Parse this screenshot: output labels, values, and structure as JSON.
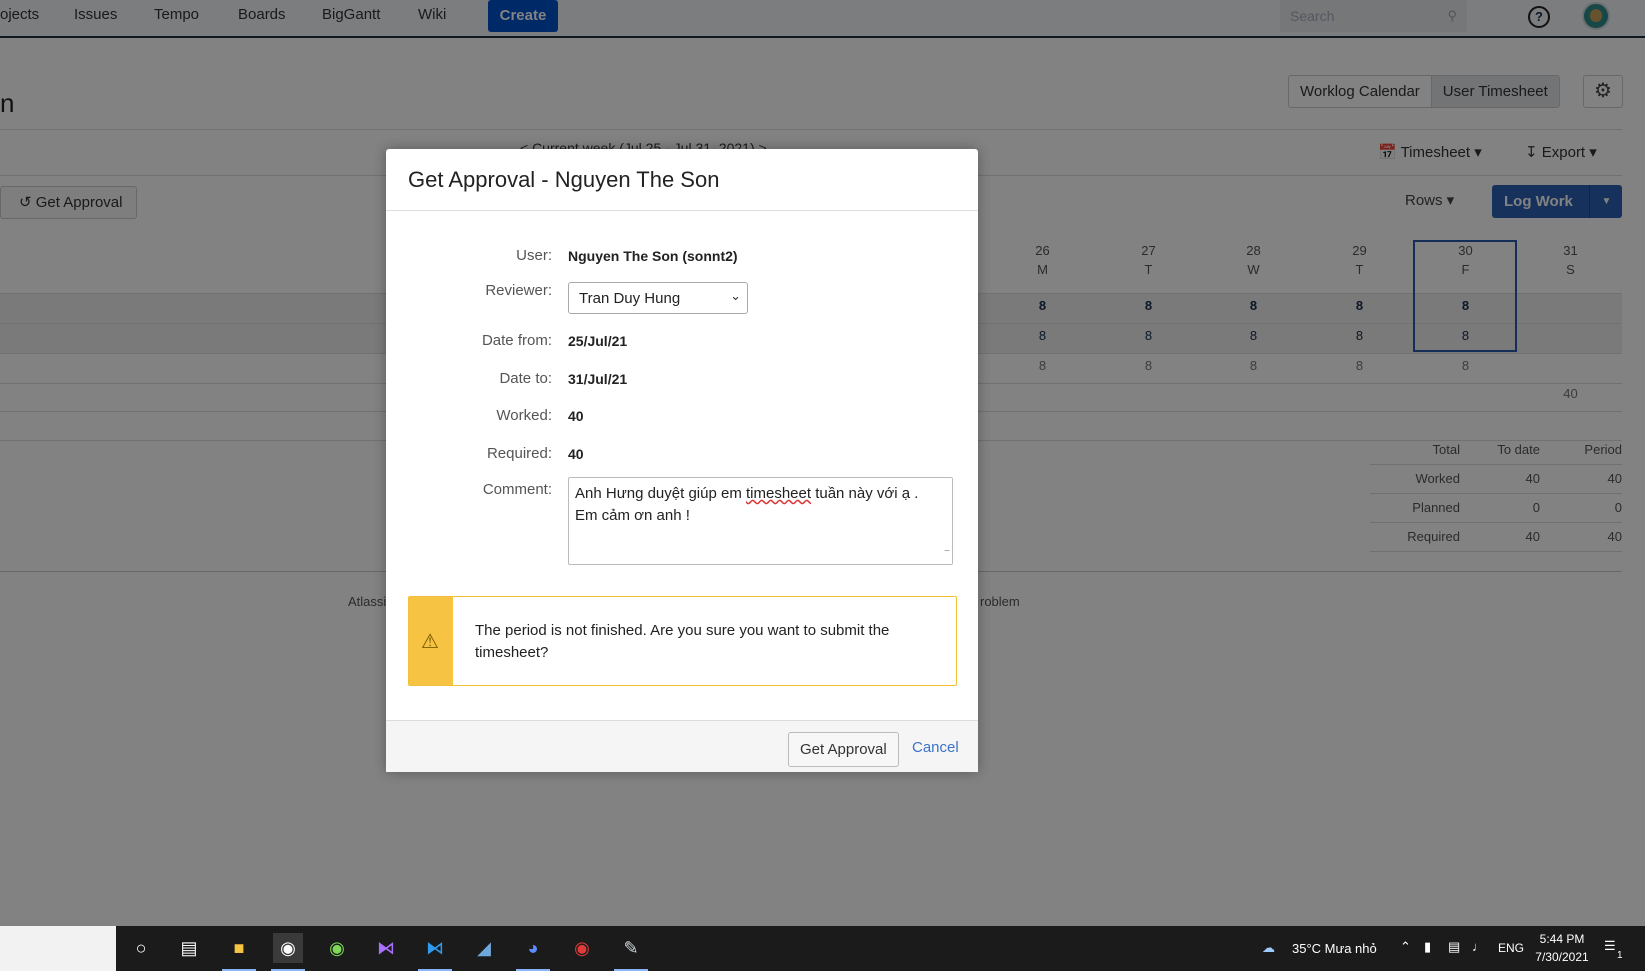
{
  "nav": {
    "items": [
      "ojects",
      "Issues",
      "Tempo",
      "Boards",
      "BigGantt",
      "Wiki"
    ],
    "create_label": "Create",
    "search_placeholder": "Search"
  },
  "page": {
    "title_fragment": "n",
    "view_tabs": [
      "Worklog Calendar",
      "User Timesheet"
    ],
    "period_nav": "< Current week (Jul 25 - Jul 31, 2021) >",
    "timesheet_label": "Timesheet",
    "export_label": "Export",
    "get_approval_bg": "Get Approval",
    "rows_label": "Rows",
    "log_work_label": "Log Work",
    "days": [
      {
        "num": "26",
        "dow": "M"
      },
      {
        "num": "27",
        "dow": "T"
      },
      {
        "num": "28",
        "dow": "W"
      },
      {
        "num": "29",
        "dow": "T"
      },
      {
        "num": "30",
        "dow": "F"
      },
      {
        "num": "31",
        "dow": "S"
      }
    ],
    "row_values": [
      [
        "8",
        "8",
        "8",
        "8",
        "8",
        ""
      ],
      [
        "8",
        "8",
        "8",
        "8",
        "8",
        ""
      ],
      [
        "8",
        "8",
        "8",
        "8",
        "8",
        ""
      ]
    ],
    "week_total": "40",
    "totals": {
      "headers": [
        "Total",
        "To date",
        "Period"
      ],
      "rows": [
        {
          "label": "Worked",
          "to_date": "40",
          "period": "40"
        },
        {
          "label": "Planned",
          "to_date": "0",
          "period": "0"
        },
        {
          "label": "Required",
          "to_date": "40",
          "period": "40"
        }
      ]
    },
    "footer_left": "Atlassi",
    "footer_right": "roblem"
  },
  "dialog": {
    "title": "Get Approval - Nguyen The Son",
    "user_label": "User:",
    "user_value": "Nguyen The Son (sonnt2)",
    "reviewer_label": "Reviewer:",
    "reviewer_value": "Tran Duy Hung",
    "date_from_label": "Date from:",
    "date_from_value": "25/Jul/21",
    "date_to_label": "Date to:",
    "date_to_value": "31/Jul/21",
    "worked_label": "Worked:",
    "worked_value": "40",
    "required_label": "Required:",
    "required_value": "40",
    "comment_label": "Comment:",
    "comment_line1_a": "Anh Hưng duyệt giúp em ",
    "comment_line1_b": "timesheet",
    "comment_line1_c": " tuần này với ạ .",
    "comment_line2": "Em cảm ơn anh !",
    "warning_text": "The period is not finished. Are you sure you want to submit the timesheet?",
    "approve_label": "Get Approval",
    "cancel_label": "Cancel"
  },
  "taskbar": {
    "weather": "35°C  Mưa nhỏ",
    "lang": "ENG",
    "time": "5:44 PM",
    "date": "7/30/2021",
    "notif_count": "1"
  },
  "colors": {
    "accent": "#0052cc",
    "warning": "#f6c343",
    "link": "#3b73c8"
  }
}
